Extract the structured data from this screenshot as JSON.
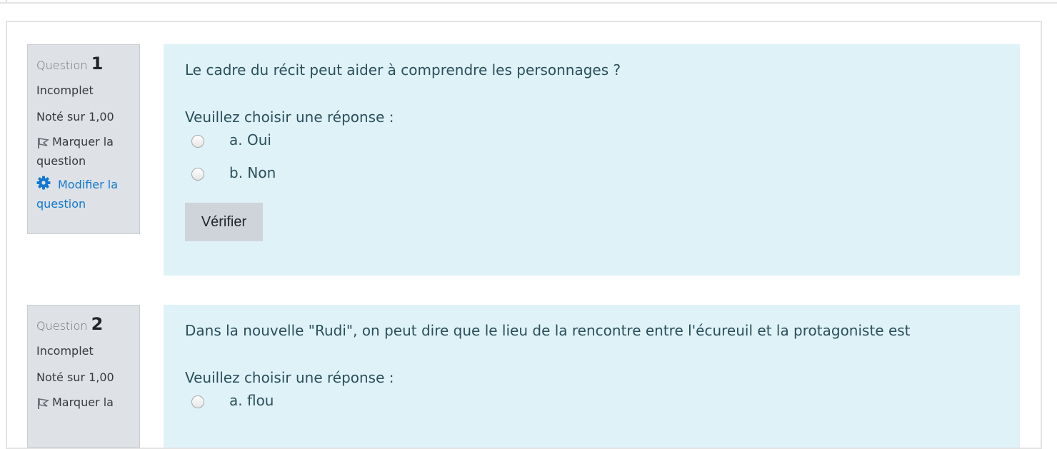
{
  "questions": [
    {
      "label": "Question",
      "number": "1",
      "state": "Incomplet",
      "grade": "Noté sur 1,00",
      "flag_label": "Marquer la question",
      "edit_label": "Modifier la question",
      "text": "Le cadre du récit peut aider à comprendre les personnages ?",
      "prompt": "Veuillez choisir une réponse :",
      "answers": [
        "a. Oui",
        "b. Non"
      ],
      "check_label": "Vérifier"
    },
    {
      "label": "Question",
      "number": "2",
      "state": "Incomplet",
      "grade": "Noté sur 1,00",
      "flag_label": "Marquer la",
      "text": "Dans la nouvelle \"Rudi\", on peut dire que le lieu de la rencontre entre l'écureuil et la protagoniste est",
      "prompt": "Veuillez choisir une réponse :",
      "answers": [
        "a. flou"
      ]
    }
  ],
  "icons": {
    "flag": "flag-icon",
    "gear": "gear-icon"
  },
  "colors": {
    "info_bg": "#dee2e6",
    "content_bg": "#def2f8",
    "link": "#1177d1",
    "button_bg": "#ced4da"
  }
}
